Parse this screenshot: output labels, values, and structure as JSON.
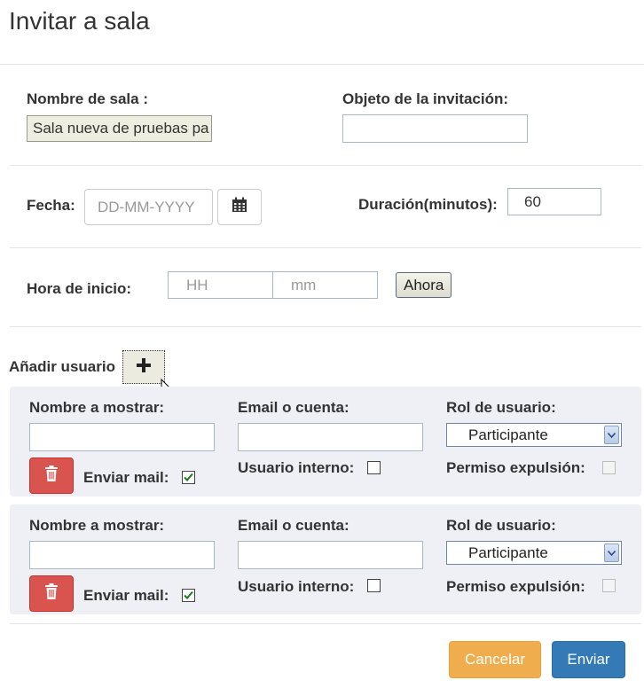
{
  "dialog": {
    "title": "Invitar a sala"
  },
  "room": {
    "name_label": "Nombre de sala :",
    "name_value": "Sala nueva de pruebas pa",
    "subject_label": "Objeto de la invitación:",
    "subject_value": ""
  },
  "date": {
    "label": "Fecha:",
    "placeholder": "DD-MM-YYYY",
    "calendar_icon": "calendar-icon"
  },
  "duration": {
    "label": "Duración(minutos):",
    "value": "60"
  },
  "start_time": {
    "label": "Hora de inicio:",
    "hour_placeholder": "HH",
    "minute_placeholder": "mm",
    "now_button": "Ahora"
  },
  "users": {
    "add_label": "Añadir usuario",
    "add_icon": "plus-icon",
    "display_name_label": "Nombre a mostrar:",
    "email_label": "Email o cuenta:",
    "role_label": "Rol de usuario:",
    "send_mail_label": "Enviar mail:",
    "internal_label": "Usuario interno:",
    "expel_label": "Permiso expulsión:",
    "rows": [
      {
        "display_name": "",
        "email": "",
        "role": "Participante",
        "send_mail": true,
        "internal": false,
        "expel": false
      },
      {
        "display_name": "",
        "email": "",
        "role": "Participante",
        "send_mail": true,
        "internal": false,
        "expel": false
      }
    ]
  },
  "footer": {
    "cancel_label": "Cancelar",
    "send_label": "Enviar"
  },
  "colors": {
    "danger": "#d9534f",
    "warning": "#f0ad4e",
    "primary": "#337ab7",
    "panel": "#eef0f5",
    "check": "#1a7a1a"
  }
}
